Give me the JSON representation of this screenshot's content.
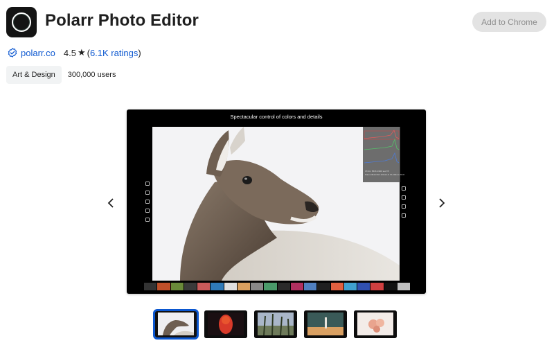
{
  "header": {
    "app_name": "Polarr Photo Editor",
    "add_button_label": "Add to Chrome"
  },
  "meta": {
    "publisher": "polarr.co",
    "rating": "4.5",
    "ratings_count_open": "(",
    "ratings_count": "6.1K ratings",
    "ratings_count_close": ")"
  },
  "category": {
    "chip_label": "Art & Design",
    "users": "300,000 users"
  },
  "carousel": {
    "caption": "Spectacular control of colors and details",
    "histogram_line1": "3744 x 5616      1/200 sec      f/5",
    "histogram_line2": "Nikon D810   ISO 100   AF-S 70-200mm f/2.8",
    "selected_index": 0,
    "thumbnail_count": 5
  },
  "icons": {
    "app": "polarr-ring-icon",
    "verified": "verified-badge-icon",
    "star": "star-icon",
    "prev": "chevron-left-icon",
    "next": "chevron-right-icon"
  },
  "colors": {
    "accent": "#0b57d0",
    "button_bg": "#e3e3e3",
    "button_text": "#8e8e8e",
    "chip_bg": "#f1f3f4"
  }
}
